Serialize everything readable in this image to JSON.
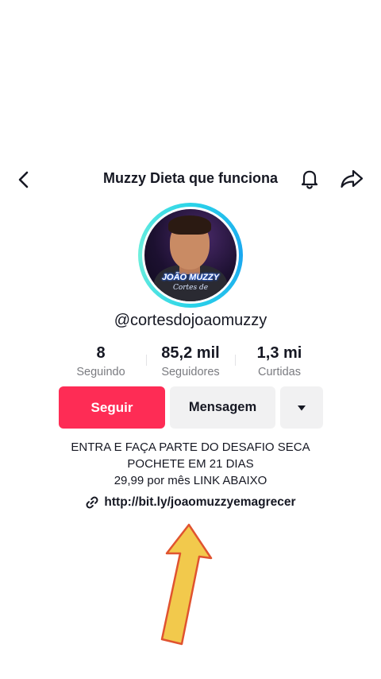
{
  "header": {
    "title": "Muzzy Dieta que funciona",
    "back_icon": "chevron-left-icon",
    "bell_icon": "bell-icon",
    "share_icon": "share-arrow-icon"
  },
  "avatar": {
    "overlay_title": "JOÃO MUZZY",
    "overlay_subtitle": "Cortes de",
    "ring_color": "#2ad4e8"
  },
  "profile": {
    "username": "@cortesdojoaomuzzy"
  },
  "stats": [
    {
      "value": "8",
      "label": "Seguindo"
    },
    {
      "value": "85,2 mil",
      "label": "Seguidores"
    },
    {
      "value": "1,3 mi",
      "label": "Curtidas"
    }
  ],
  "actions": {
    "follow_label": "Seguir",
    "message_label": "Mensagem",
    "more_icon": "triangle-down-icon",
    "follow_color": "#fe2c55"
  },
  "bio": {
    "line1": "ENTRA E FAÇA PARTE DO DESAFIO SECA",
    "line2": "POCHETE EM 21 DIAS",
    "line3": "29,99 por mês LINK ABAIXO",
    "link": "http://bit.ly/joaomuzzyemagrecer",
    "link_icon": "link-icon"
  },
  "annotation": {
    "icon": "up-arrow-icon",
    "fill_color": "#f2c94c",
    "stroke_color": "#e0532f"
  }
}
